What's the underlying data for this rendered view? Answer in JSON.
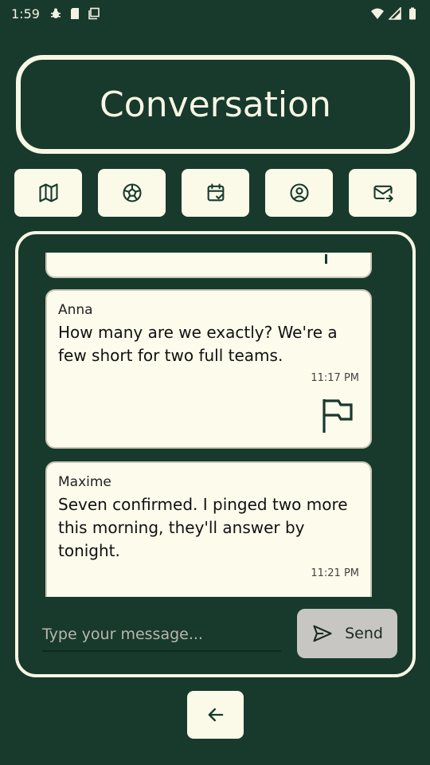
{
  "status_bar": {
    "time": "1:59",
    "icons": [
      "bug-icon",
      "sd-card-icon",
      "copy-icon",
      "wifi-icon",
      "signal-icon",
      "battery-icon"
    ]
  },
  "header": {
    "title": "Conversation"
  },
  "nav": {
    "items": [
      {
        "icon": "map-icon"
      },
      {
        "icon": "soccer-ball-icon"
      },
      {
        "icon": "calendar-check-icon"
      },
      {
        "icon": "profile-icon"
      },
      {
        "icon": "mail-forward-icon"
      }
    ]
  },
  "messages": [
    {
      "author": "Anna",
      "text": "How many are we exactly? We're a few short for two full teams.",
      "time": "11:17 PM",
      "flag_icon": "flag-icon"
    },
    {
      "author": "Maxime",
      "text": "Seven confirmed. I pinged two more this morning, they'll answer by tonight.",
      "time": "11:21 PM"
    }
  ],
  "composer": {
    "placeholder": "Type your message...",
    "value": "",
    "send_label": "Send",
    "send_icon": "send-icon"
  },
  "footer": {
    "back_icon": "arrow-left-icon"
  },
  "colors": {
    "background": "#173a2c",
    "card": "#fcfbec",
    "accent_light": "#f8f6e4",
    "send_button": "#c7c6c2"
  }
}
